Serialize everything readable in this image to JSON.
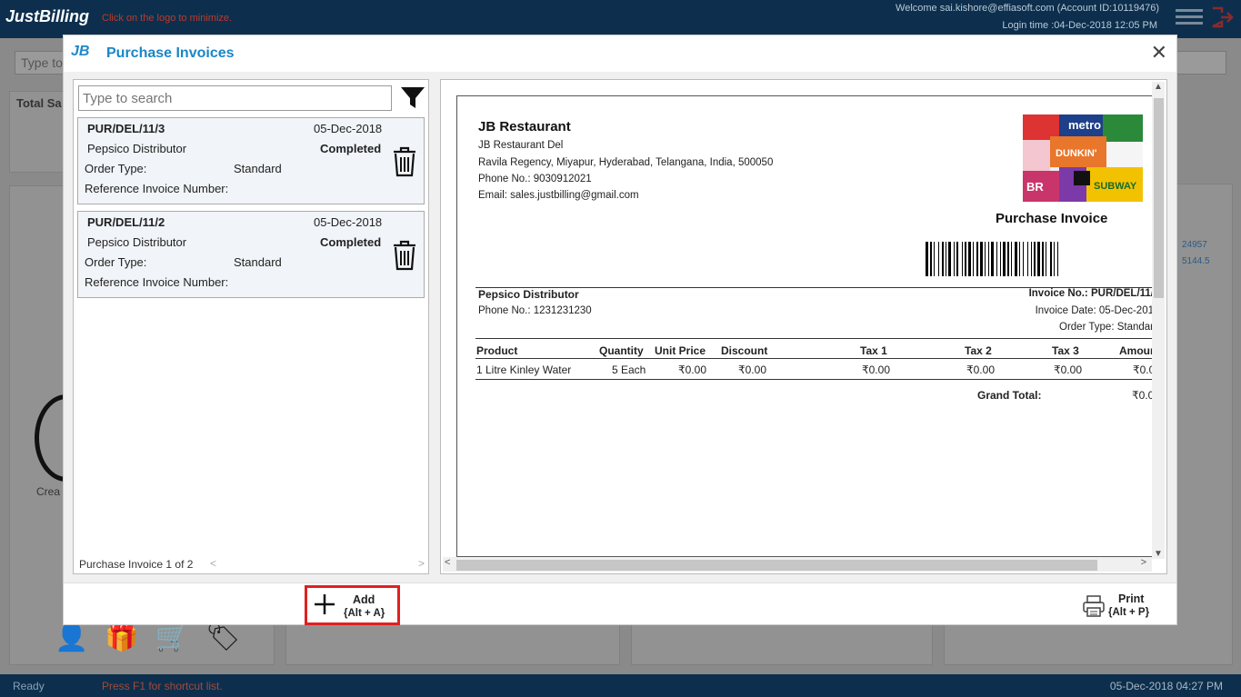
{
  "app": {
    "logo": "JustBilling",
    "logo_hint": "Click on the logo to minimize.",
    "welcome": "Welcome sai.kishore@effiasoft.com (Account ID:10119476)",
    "login_time": "Login time :04-Dec-2018 12:05 PM",
    "background_search_placeholder": "Type to",
    "background_total_label": "Total Sa",
    "background_value_1": "24957",
    "background_value_2": "5144.5",
    "background_create_label": "Crea"
  },
  "status_bar": {
    "ready": "Ready",
    "hint": "Press F1 for shortcut list.",
    "datetime": "05-Dec-2018 04:27 PM"
  },
  "modal": {
    "logo": "JB",
    "title": "Purchase Invoices",
    "search_placeholder": "Type to search",
    "invoices": [
      {
        "number": "PUR/DEL/11/3",
        "date": "05-Dec-2018",
        "vendor": "Pepsico Distributor",
        "status": "Completed",
        "order_type_label": "Order Type:",
        "order_type": "Standard",
        "reference_label": "Reference Invoice Number:"
      },
      {
        "number": "PUR/DEL/11/2",
        "date": "05-Dec-2018",
        "vendor": "Pepsico Distributor",
        "status": "Completed",
        "order_type_label": "Order Type:",
        "order_type": "Standard",
        "reference_label": "Reference Invoice Number:"
      }
    ],
    "page_indicator": "Purchase Invoice 1 of 2",
    "add": {
      "label": "Add",
      "shortcut": "{Alt + A}"
    },
    "print": {
      "label": "Print",
      "shortcut": "{Alt + P}"
    }
  },
  "preview": {
    "restaurant_name": "JB Restaurant",
    "restaurant_lines": [
      "JB Restaurant Del",
      "Ravila Regency, Miyapur, Hyderabad, Telangana, India, 500050",
      "Phone No.: 9030912021",
      "Email: sales.justbilling@gmail.com"
    ],
    "doc_title": "Purchase Invoice",
    "vendor_name": "Pepsico Distributor",
    "vendor_phone": "Phone No.: 1231231230",
    "invoice_no_label": "Invoice No.:",
    "invoice_no": "PUR/DEL/11/",
    "invoice_date": "Invoice Date: 05-Dec-201",
    "order_type": "Order Type: Standar",
    "columns": [
      "Product",
      "Quantity",
      "Unit Price",
      "Discount",
      "Tax 1",
      "Tax 2",
      "Tax 3",
      "Amour"
    ],
    "row": [
      "1 Litre Kinley Water",
      "5 Each",
      "₹0.00",
      "₹0.00",
      "₹0.00",
      "₹0.00",
      "₹0.00",
      "₹0.0"
    ],
    "grand_total_label": "Grand Total:",
    "grand_total": "₹0.0"
  }
}
